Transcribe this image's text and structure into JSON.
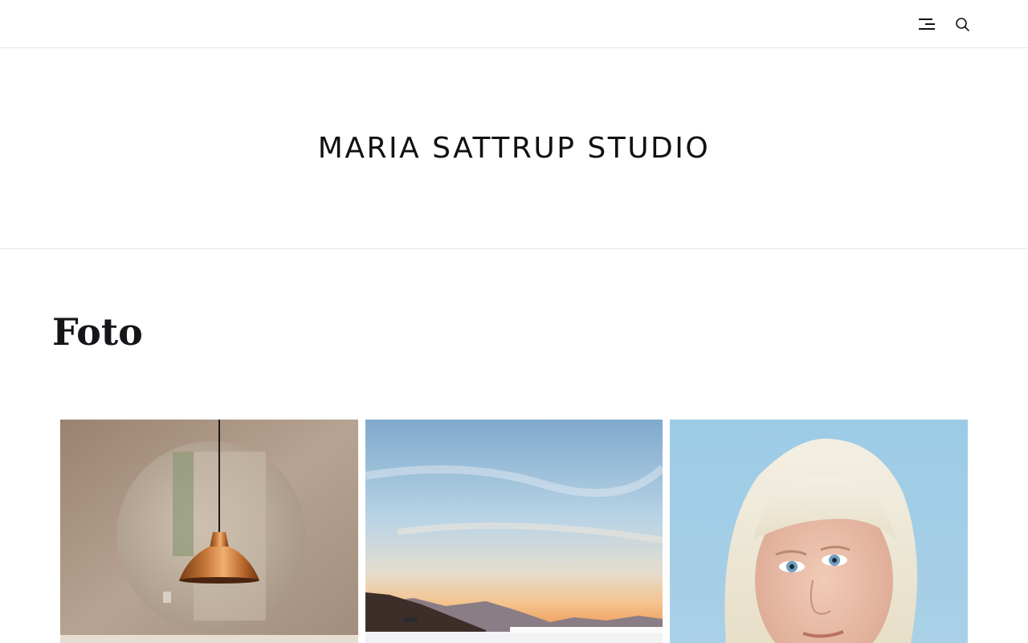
{
  "site": {
    "title": "MARIA SATTRUP STUDIO"
  },
  "header": {
    "menu_icon": "hamburger-menu-icon",
    "search_icon": "search-icon"
  },
  "page": {
    "title": "Foto"
  },
  "gallery": {
    "items": [
      {
        "subject": "copper pendant lamp in front of round mirror"
      },
      {
        "subject": "sunset sky over desert hills with modern house"
      },
      {
        "subject": "portrait of blonde woman with blue eyes"
      }
    ]
  },
  "colors": {
    "text": "#111111",
    "divider": "#e6e6e6",
    "background": "#ffffff"
  }
}
